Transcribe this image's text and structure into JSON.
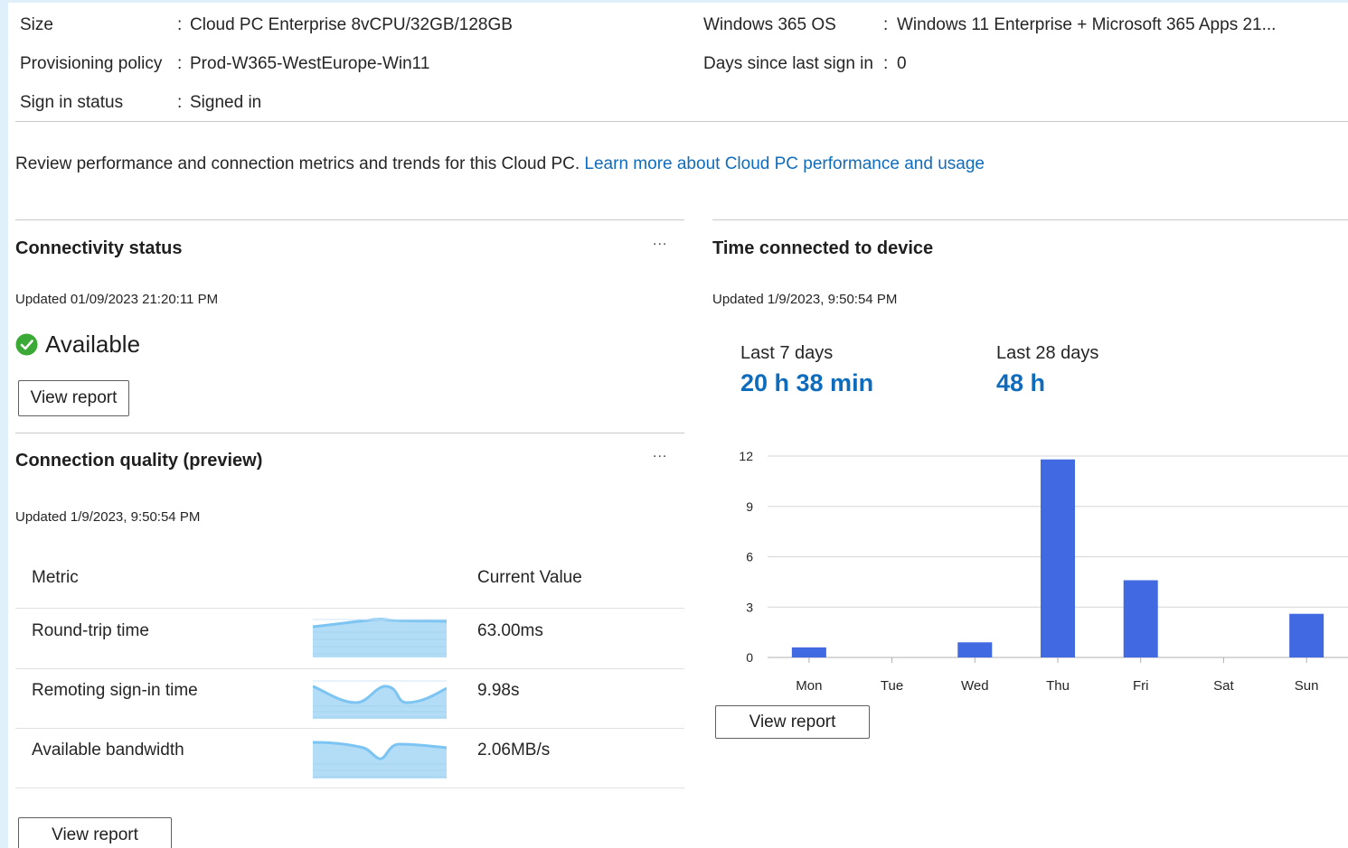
{
  "properties": {
    "left": [
      {
        "label": "Size",
        "value": "Cloud PC Enterprise 8vCPU/32GB/128GB"
      },
      {
        "label": "Provisioning policy",
        "value": "Prod-W365-WestEurope-Win11"
      },
      {
        "label": "Sign in status",
        "value": "Signed in"
      }
    ],
    "right": [
      {
        "label": "Windows 365 OS",
        "value": "Windows 11 Enterprise + Microsoft 365 Apps 21..."
      },
      {
        "label": "Days since last sign in",
        "value": "0"
      }
    ],
    "colon": ":"
  },
  "intro": {
    "text": "Review performance and connection metrics and trends for this Cloud PC. ",
    "link": "Learn more about Cloud PC performance and usage"
  },
  "connectivity": {
    "title": "Connectivity status",
    "updated": "Updated 01/09/2023 21:20:11 PM",
    "status": "Available",
    "button": "View report",
    "more": "..."
  },
  "quality": {
    "title": "Connection quality (preview)",
    "updated": "Updated 1/9/2023, 9:50:54 PM",
    "more": "...",
    "headers": {
      "metric": "Metric",
      "value": "Current Value"
    },
    "rows": [
      {
        "metric": "Round-trip time",
        "value": "63.00ms"
      },
      {
        "metric": "Remoting sign-in time",
        "value": "9.98s"
      },
      {
        "metric": "Available bandwidth",
        "value": "2.06MB/s"
      }
    ],
    "button": "View report"
  },
  "time_connected": {
    "title": "Time connected to device",
    "updated": "Updated 1/9/2023, 9:50:54 PM",
    "last7_label": "Last 7 days",
    "last7_value": "20 h 38 min",
    "last28_label": "Last 28 days",
    "last28_value": "48 h",
    "button": "View report"
  },
  "colors": {
    "accent": "#0f6cbd",
    "bar": "#4169e1",
    "success": "#3aa935",
    "spark_fill": "#b3dcf7",
    "spark_line": "#7cc4f2"
  },
  "chart_data": {
    "type": "bar",
    "categories": [
      "Mon",
      "Tue",
      "Wed",
      "Thu",
      "Fri",
      "Sat",
      "Sun"
    ],
    "values": [
      0.6,
      0,
      0.9,
      11.8,
      4.6,
      0,
      2.6
    ],
    "yticks": [
      0,
      3,
      6,
      9,
      12
    ],
    "ylim": [
      0,
      12
    ],
    "title": "",
    "xlabel": "",
    "ylabel": "",
    "grid": true
  }
}
